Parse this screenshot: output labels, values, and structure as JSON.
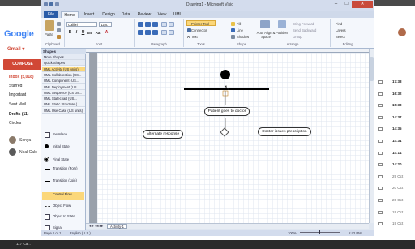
{
  "window": {
    "title": "Drawing1 - Microsoft Visio",
    "controls": {
      "minimize": "–",
      "maximize": "□",
      "close": "✕"
    }
  },
  "tabs": [
    "File",
    "Home",
    "Insert",
    "Design",
    "Data",
    "Review",
    "View",
    "UML"
  ],
  "ribbon": {
    "clipboard": {
      "paste": "Paste",
      "cut": "Cut",
      "copy": "Copy",
      "label": "Clipboard"
    },
    "font": {
      "name": "Calibri",
      "size": "12pt.",
      "label": "Font"
    },
    "paragraph": {
      "label": "Paragraph"
    },
    "tools": {
      "pointer": "Pointer Tool",
      "connector": "Connector",
      "text": "Text",
      "label": "Tools"
    },
    "shape": {
      "fill": "Fill",
      "line": "Line",
      "shadow": "Shadow",
      "label": "Shape"
    },
    "arrange": {
      "auto_align": "Auto Align & Space",
      "position": "Position",
      "bring_forward": "Bring Forward",
      "send_backward": "Send Backward",
      "group": "Group",
      "label": "Arrange"
    },
    "editing": {
      "find": "Find",
      "layers": "Layers",
      "select": "Select",
      "label": "Editing"
    }
  },
  "shapes_panel": {
    "header": "Shapes",
    "stencils": [
      "More Shapes",
      "Quick Shapes",
      "UML Activity (US units)",
      "UML Collaboration (US...",
      "UML Component (US...",
      "UML Deployment (US...",
      "UML Sequence (US uni...",
      "UML Statechart (US...",
      "UML Static Structure (...",
      "UML Use Case (US units)"
    ],
    "selected_index": 2,
    "items": [
      "Swimlane",
      "Initial State",
      "Final State",
      "Transition (Fork)",
      "Transition (Join)",
      "Control Flow",
      "Object Flow",
      "Object In State",
      "Signal"
    ]
  },
  "diagram": {
    "activities": [
      "Patient goes to doctor",
      "Alternate response",
      "Doctor issues prescription"
    ]
  },
  "page_tabs": {
    "current": "Activity-1"
  },
  "status": {
    "page": "Page 1 of 1",
    "language": "English (U.S.)",
    "zoom": "100%",
    "time": "5:42 PM"
  },
  "gmail": {
    "logo": "Google",
    "label": "Gmail ▾",
    "compose": "COMPOSE",
    "nav": [
      "Inbox (5,018)",
      "Starred",
      "Important",
      "Sent Mail",
      "Drafts (11)",
      "Circles"
    ],
    "contacts": [
      "Sonya",
      "Neal Calo"
    ],
    "times": [
      "17:38",
      "16:32",
      "15:33",
      "14:37",
      "14:35",
      "14:31",
      "14:14",
      "14:20",
      "29 Oct",
      "20 Oct",
      "20 Oct",
      "19 Oct",
      "19 Oct"
    ],
    "taskbar": "117 Ca..."
  }
}
